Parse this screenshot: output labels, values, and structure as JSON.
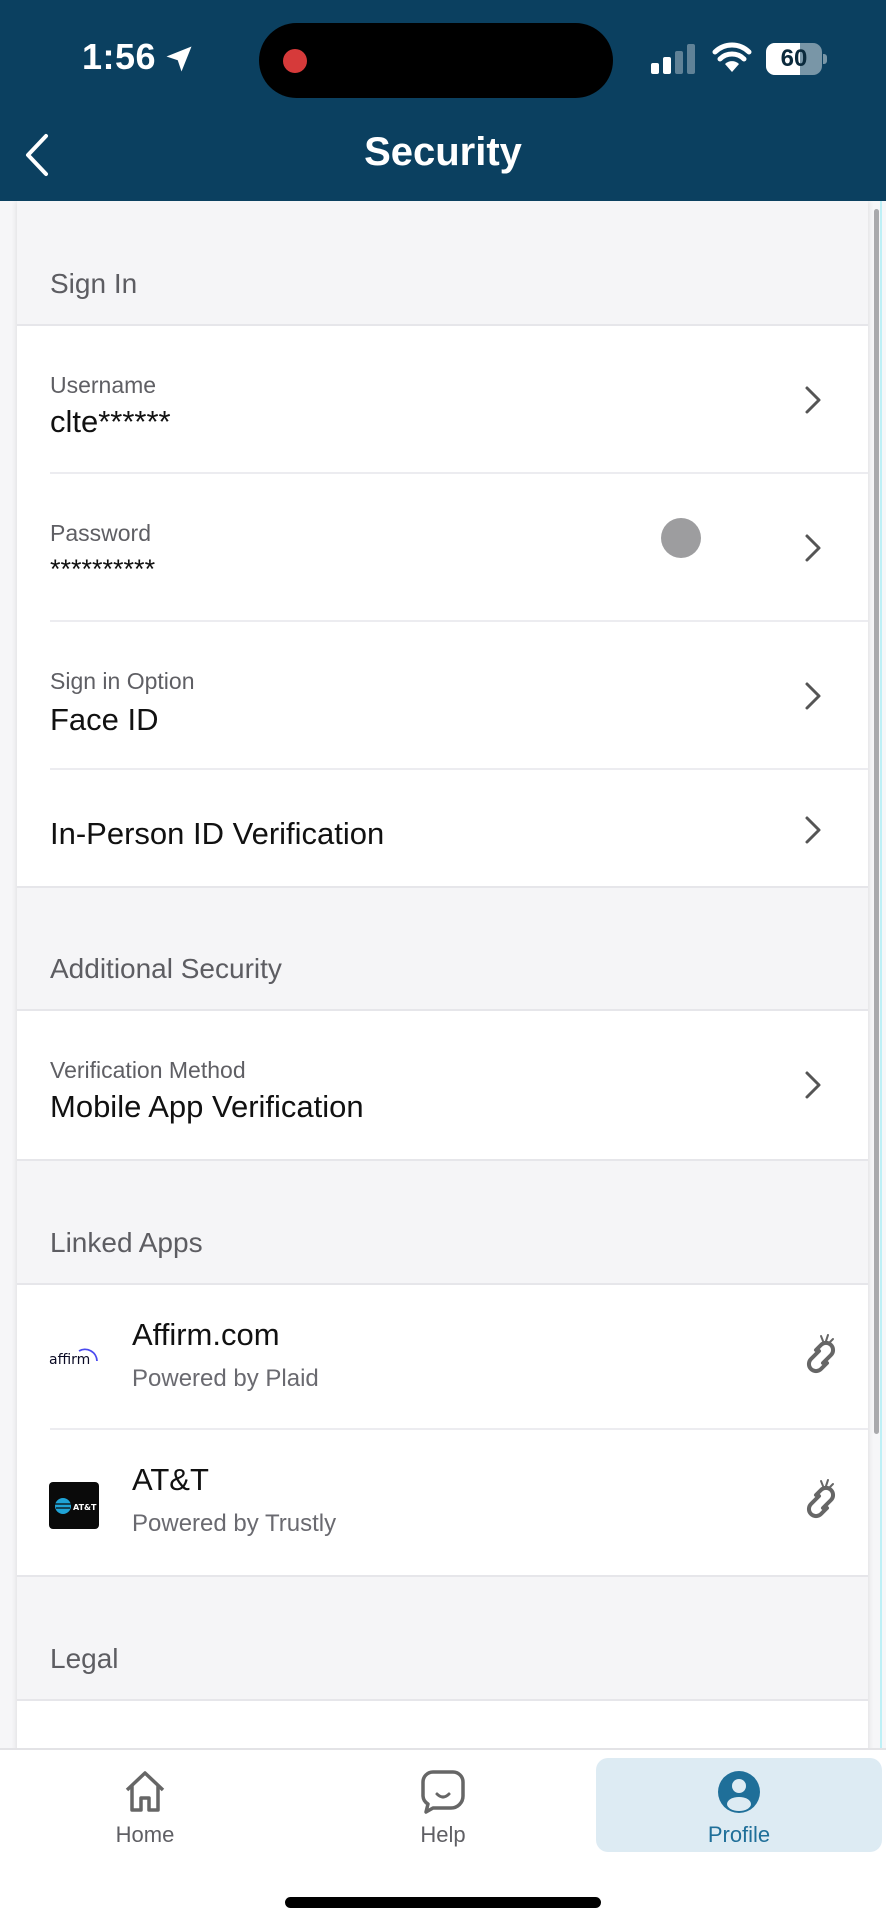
{
  "status_bar": {
    "time": "1:56",
    "battery_percent": "60",
    "battery_level": 0.6,
    "signal_bars_active": 2,
    "signal_bars_total": 4,
    "recording_indicator_color": "#d63a3a"
  },
  "header": {
    "title": "Security",
    "back_icon": "chevron-left-icon",
    "background_color": "#0b4060"
  },
  "sections": {
    "sign_in": {
      "title": "Sign In",
      "items": [
        {
          "label": "Username",
          "value": "clte******"
        },
        {
          "label": "Password",
          "value": "**********"
        },
        {
          "label": "Sign in Option",
          "value": "Face ID"
        },
        {
          "label": "",
          "value": "In-Person ID Verification"
        }
      ]
    },
    "additional_security": {
      "title": "Additional Security",
      "items": [
        {
          "label": "Verification Method",
          "value": "Mobile App Verification"
        }
      ]
    },
    "linked_apps": {
      "title": "Linked Apps",
      "items": [
        {
          "name": "Affirm.com",
          "powered_by": "Powered by Plaid",
          "logo_text": "affirm",
          "action_icon": "unlink-icon"
        },
        {
          "name": "AT&T",
          "powered_by": "Powered by Trustly",
          "logo_text": "AT&T",
          "action_icon": "unlink-icon"
        }
      ]
    },
    "legal": {
      "title": "Legal"
    }
  },
  "tabbar": {
    "tabs": [
      {
        "label": "Home",
        "icon": "home-icon",
        "active": false
      },
      {
        "label": "Help",
        "icon": "chat-bubble-icon",
        "active": false
      },
      {
        "label": "Profile",
        "icon": "profile-icon",
        "active": true
      }
    ],
    "active_color": "#1f6f99",
    "active_bg": "#ddebf3"
  }
}
